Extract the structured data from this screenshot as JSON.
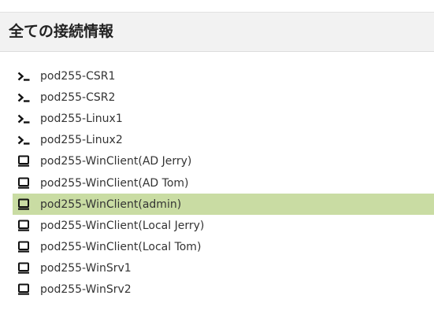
{
  "header": {
    "title": "全ての接続情報"
  },
  "connections": [
    {
      "label": "pod255-CSR1",
      "icon": "terminal-icon",
      "selected": false
    },
    {
      "label": "pod255-CSR2",
      "icon": "terminal-icon",
      "selected": false
    },
    {
      "label": "pod255-Linux1",
      "icon": "terminal-icon",
      "selected": false
    },
    {
      "label": "pod255-Linux2",
      "icon": "terminal-icon",
      "selected": false
    },
    {
      "label": "pod255-WinClient(AD Jerry)",
      "icon": "monitor-icon",
      "selected": false
    },
    {
      "label": "pod255-WinClient(AD Tom)",
      "icon": "monitor-icon",
      "selected": false
    },
    {
      "label": "pod255-WinClient(admin)",
      "icon": "monitor-icon",
      "selected": true
    },
    {
      "label": "pod255-WinClient(Local Jerry)",
      "icon": "monitor-icon",
      "selected": false
    },
    {
      "label": "pod255-WinClient(Local Tom)",
      "icon": "monitor-icon",
      "selected": false
    },
    {
      "label": "pod255-WinSrv1",
      "icon": "monitor-icon",
      "selected": false
    },
    {
      "label": "pod255-WinSrv2",
      "icon": "monitor-icon",
      "selected": false
    }
  ],
  "colors": {
    "selected_row": "#c9dca3",
    "header_bg": "#f2f2f2",
    "text": "#333333"
  }
}
